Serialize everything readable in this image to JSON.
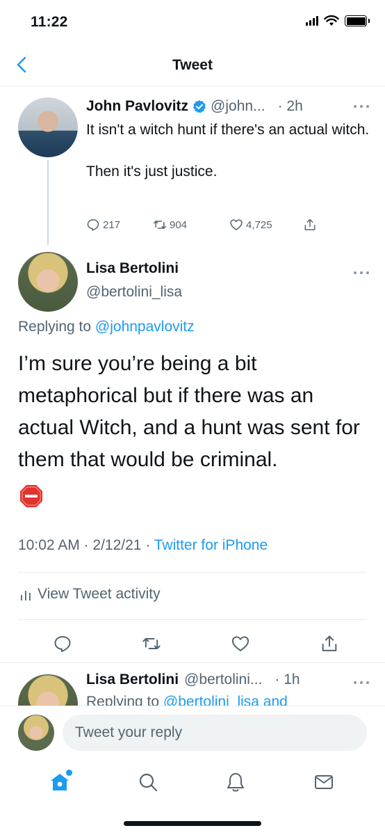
{
  "status_bar": {
    "time": "11:22"
  },
  "header": {
    "title": "Tweet",
    "back_icon": "chevron-left-icon"
  },
  "parent_tweet": {
    "name": "John Pavlovitz",
    "handle": "@john...",
    "time": "· 2h",
    "body": "It isn't a witch hunt if there's an actual witch.\n\nThen it's just justice.",
    "replies": "217",
    "retweets": "904",
    "likes": "4,725"
  },
  "focal_tweet": {
    "name": "Lisa Bertolini",
    "handle": "@bertolini_lisa",
    "replying_prefix": "Replying to ",
    "replying_to": "@johnpavlovitz",
    "text": "I’m sure you’re being a bit metaphorical but if there was an actual Witch, and a hunt was sent for them that would be criminal.",
    "emoji": "stop-sign-icon",
    "timestamp": "10:02 AM · 2/12/21 · ",
    "source": "Twitter for iPhone",
    "activity_label": "View Tweet activity"
  },
  "reply_preview": {
    "name": "Lisa Bertolini",
    "handle": "@bertolini...",
    "time": "· 1h",
    "replying_prefix": "Replying to ",
    "replying_to": "@bertolini_lisa and"
  },
  "composer": {
    "placeholder": "Tweet your reply"
  },
  "colors": {
    "accent": "#1d9bf0",
    "muted": "#536471",
    "text": "#0f1419",
    "stop": "#e0342f"
  }
}
